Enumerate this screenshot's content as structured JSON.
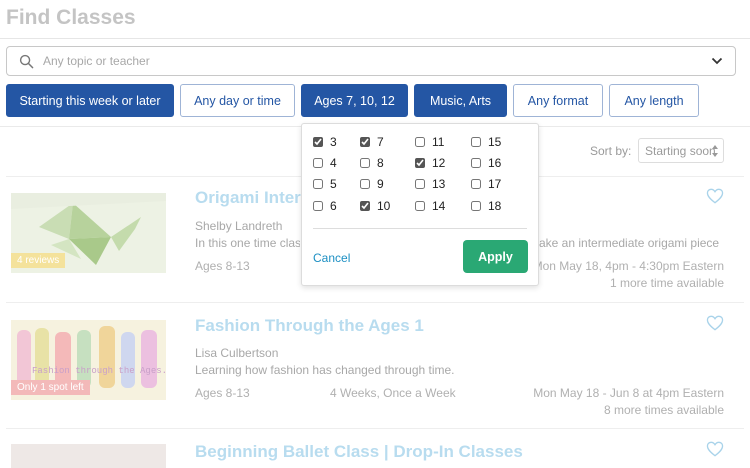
{
  "page": {
    "title": "Find Classes"
  },
  "search": {
    "placeholder": "Any topic or teacher"
  },
  "filters": [
    {
      "label": "Starting this week or later",
      "active": true
    },
    {
      "label": "Any day or time",
      "active": false
    },
    {
      "label": "Ages 7, 10, 12",
      "active": true
    },
    {
      "label": "Music, Arts",
      "active": true
    },
    {
      "label": "Any format",
      "active": false
    },
    {
      "label": "Any length",
      "active": false
    }
  ],
  "sort": {
    "label": "Sort by:",
    "value": "Starting soon"
  },
  "age_dropdown": {
    "options": [
      {
        "age": "3",
        "checked": true
      },
      {
        "age": "4",
        "checked": false
      },
      {
        "age": "5",
        "checked": false
      },
      {
        "age": "6",
        "checked": false
      },
      {
        "age": "7",
        "checked": true
      },
      {
        "age": "8",
        "checked": false
      },
      {
        "age": "9",
        "checked": false
      },
      {
        "age": "10",
        "checked": true
      },
      {
        "age": "11",
        "checked": false
      },
      {
        "age": "12",
        "checked": true
      },
      {
        "age": "13",
        "checked": false
      },
      {
        "age": "14",
        "checked": false
      },
      {
        "age": "15",
        "checked": false
      },
      {
        "age": "16",
        "checked": false
      },
      {
        "age": "17",
        "checked": false
      },
      {
        "age": "18",
        "checked": false
      }
    ],
    "cancel_label": "Cancel",
    "apply_label": "Apply"
  },
  "classes": [
    {
      "title": "Origami Inter",
      "teacher": "Shelby Landreth",
      "description_left": "In this one time clas",
      "description_right": "ake an intermediate origami piece",
      "ages": "Ages 8-13",
      "frequency": "",
      "schedule": "Mon May 18, 4pm - 4:30pm Eastern",
      "more_times": "1 more time available",
      "badge": "4 reviews",
      "badge_color": "#f2d35a"
    },
    {
      "title": "Fashion Through the Ages 1",
      "teacher": "Lisa Culbertson",
      "description_left": "Learning how fashion has changed through time.",
      "description_right": "",
      "ages": "Ages 8-13",
      "frequency": "4 Weeks, Once a Week",
      "schedule": "Mon May 18 - Jun 8 at 4pm Eastern",
      "more_times": "8 more times available",
      "badge": "Only 1 spot left",
      "badge_color": "#f0a6a6",
      "image_caption": "Fashion through the Ages."
    },
    {
      "title": "Beginning Ballet Class | Drop-In Classes"
    }
  ]
}
